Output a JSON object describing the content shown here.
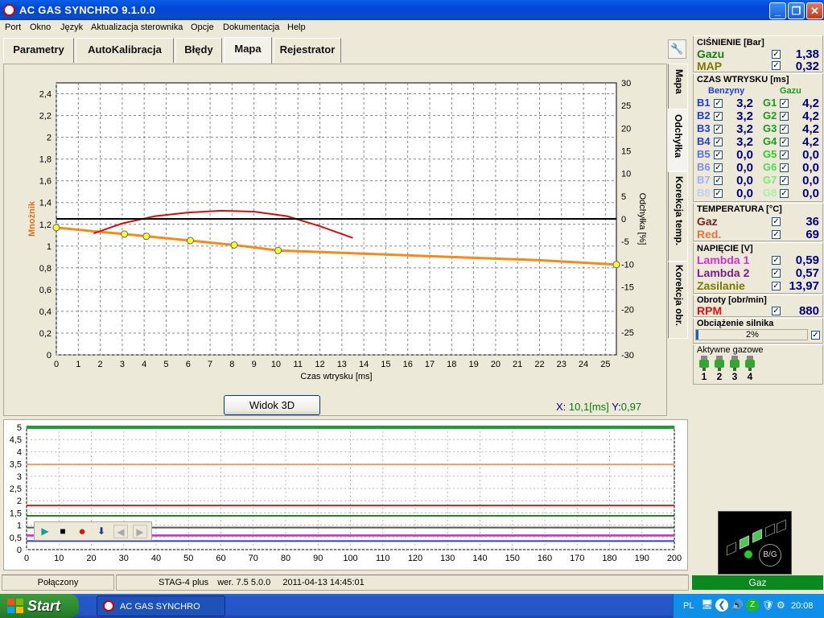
{
  "titlebar": {
    "title": "AC GAS SYNCHRO  9.1.0.0"
  },
  "menu": [
    "Port",
    "Okno",
    "Język",
    "Aktualizacja sterownika",
    "Opcje",
    "Dokumentacja",
    "Help"
  ],
  "tabs": [
    "Parametry",
    "AutoKalibracja",
    "Błędy",
    "Mapa",
    "Rejestrator"
  ],
  "active_tab": "Mapa",
  "vertical_tabs": [
    "Mapa",
    "Odchyłka",
    "Korekcja temp.",
    "Korekcja obr."
  ],
  "chart_view_button": "Widok 3D",
  "cursor_readout": {
    "x_label": "X:",
    "x_value": "10,1",
    "x_unit": "[ms]",
    "y_label": "Y:",
    "y_value": "0,97"
  },
  "chart_data": [
    {
      "type": "line",
      "xlabel": "Czas wtrysku [ms]",
      "ylabel": "Mnożnik",
      "y2label": "Odchyłka [%]",
      "xlim": [
        0,
        25.5
      ],
      "ylim": [
        0,
        2.5
      ],
      "y2lim": [
        -30,
        30
      ],
      "x_ticks": [
        "0",
        "1",
        "2",
        "3",
        "4",
        "5",
        "6",
        "7",
        "8",
        "9",
        "10",
        "11",
        "12",
        "13",
        "14",
        "15",
        "16",
        "17",
        "18",
        "19",
        "20",
        "21",
        "22",
        "23",
        "24",
        "25"
      ],
      "y_ticks": [
        "0",
        "0,2",
        "0,4",
        "0,6",
        "0,8",
        "1",
        "1,2",
        "1,4",
        "1,6",
        "1,8",
        "2",
        "2,2",
        "2,4"
      ],
      "y2_ticks": [
        "30",
        "25",
        "20",
        "15",
        "10",
        "5",
        "0",
        "-5",
        "-10",
        "-15",
        "-20",
        "-25",
        "-30"
      ],
      "grid": true,
      "series": [
        {
          "role": "multiplier",
          "color": "#f28b1c",
          "axis": "left",
          "x": [
            0,
            1.5,
            3.1,
            4.1,
            6.1,
            8.1,
            10.1,
            14,
            18,
            22,
            25.5
          ],
          "y": [
            1.17,
            1.14,
            1.11,
            1.09,
            1.05,
            1.01,
            0.96,
            0.93,
            0.9,
            0.87,
            0.83
          ],
          "markers_x": [
            0,
            3.1,
            4.1,
            6.1,
            8.1,
            10.1,
            25.5
          ],
          "markers_y": [
            1.17,
            1.11,
            1.09,
            1.05,
            1.01,
            0.96,
            0.83
          ]
        },
        {
          "role": "deviation",
          "color": "#cc1111",
          "axis": "right",
          "x": [
            1.7,
            3,
            4.5,
            6,
            7.5,
            9,
            10.5,
            12,
            13.5
          ],
          "y": [
            -3.2,
            -1.0,
            0.6,
            1.4,
            1.8,
            1.6,
            0.6,
            -1.6,
            -4.2
          ]
        },
        {
          "role": "zero-line",
          "color": "#000000",
          "axis": "right",
          "x": [
            0,
            25.5
          ],
          "y": [
            0,
            0
          ]
        }
      ]
    },
    {
      "type": "line",
      "xlim": [
        0,
        200
      ],
      "ylim": [
        0,
        5
      ],
      "x_ticks": [
        "0",
        "10",
        "20",
        "30",
        "40",
        "50",
        "60",
        "70",
        "80",
        "90",
        "100",
        "110",
        "120",
        "130",
        "140",
        "150",
        "160",
        "170",
        "180",
        "190",
        "200"
      ],
      "y_ticks": [
        "0",
        "0,5",
        "1",
        "1,5",
        "2",
        "2,5",
        "3",
        "3,5",
        "4",
        "4,5",
        "5"
      ],
      "grid": true,
      "series": [
        {
          "color": "#e0a070",
          "y": 3.48
        },
        {
          "color": "#9c2b2b",
          "y": 1.8
        },
        {
          "color": "#2a7f2a",
          "y": 1.38
        },
        {
          "color": "#555555",
          "y": 0.9
        },
        {
          "color": "#7a1f8a",
          "y": 0.57
        },
        {
          "color": "#d12fd1",
          "y": 0.59
        },
        {
          "color": "#2f3fd1",
          "y": 0.35
        },
        {
          "color": "#1f9c3a",
          "y": 5.0
        }
      ]
    }
  ],
  "status": {
    "connection": "Połączony",
    "device": "STAG-4 plus",
    "version_label": "wer.",
    "version": "7.5  5.0.0",
    "datetime": "2011-04-13 14:45:01"
  },
  "panel": {
    "pressure": {
      "header": "CIŚNIENIE [Bar]",
      "gas_label": "Gazu",
      "gas_value": "1,38",
      "map_label": "MAP",
      "map_value": "0,32"
    },
    "injection": {
      "header": "CZAS WTRYSKU  [ms]",
      "petrol_header": "Benzyny",
      "gas_header": "Gazu",
      "rows": [
        {
          "b": "B1",
          "bv": "3,2",
          "g": "G1",
          "gv": "4,2",
          "bc": "#1f3fd1",
          "gc": "#1a9b1a"
        },
        {
          "b": "B2",
          "bv": "3,2",
          "g": "G2",
          "gv": "4,2",
          "bc": "#1f3fd1",
          "gc": "#1a9b1a"
        },
        {
          "b": "B3",
          "bv": "3,2",
          "g": "G3",
          "gv": "4,2",
          "bc": "#1f3fd1",
          "gc": "#1a9b1a"
        },
        {
          "b": "B4",
          "bv": "3,2",
          "g": "G4",
          "gv": "4,2",
          "bc": "#1f3fd1",
          "gc": "#1a9b1a"
        },
        {
          "b": "B5",
          "bv": "0,0",
          "g": "G5",
          "gv": "0,0",
          "bc": "#5c6ee0",
          "gc": "#2ecb2e"
        },
        {
          "b": "B6",
          "bv": "0,0",
          "g": "G6",
          "gv": "0,0",
          "bc": "#7d8de6",
          "gc": "#4fdd4f"
        },
        {
          "b": "B7",
          "bv": "0,0",
          "g": "G7",
          "gv": "0,0",
          "bc": "#a3aff0",
          "gc": "#7ae87a"
        },
        {
          "b": "B8",
          "bv": "0,0",
          "g": "G8",
          "gv": "0,0",
          "bc": "#c5cdf6",
          "gc": "#a8f0a8"
        }
      ]
    },
    "temperature": {
      "header": "TEMPERATURA  [°C]",
      "gas_label": "Gaz",
      "gas_value": "36",
      "red_label": "Red.",
      "red_value": "69"
    },
    "voltage": {
      "header": "NAPIĘCIE [V]",
      "l1_label": "Lambda 1",
      "l1_value": "0,59",
      "l2_label": "Lambda 2",
      "l2_value": "0,57",
      "supply_label": "Zasilanie",
      "supply_value": "13,97"
    },
    "rpm": {
      "header": "Obroty [obr/min]",
      "label": "RPM",
      "value": "880"
    },
    "load": {
      "header": "Obciążenie silnika",
      "value": "2%",
      "fraction": 0.02
    },
    "active_gas": {
      "header": "Aktywne gazowe",
      "injectors": [
        "1",
        "2",
        "3",
        "4"
      ]
    },
    "switch_label": "B/G",
    "mode_bar": "Gaz"
  },
  "taskbar": {
    "start": "Start",
    "task": "AC GAS SYNCHRO",
    "lang": "PL",
    "clock": "20:08"
  },
  "colors": {
    "gas_green": "#1a7a1a",
    "map_olive": "#7a7a00",
    "gas_brown": "#7a1f1f",
    "red_orange": "#e8743a",
    "lambda1": "#d12fd1",
    "lambda2": "#7a1f8a",
    "supply": "#7a7a00",
    "rpm": "#e01010",
    "orange_series": "#f28b1c"
  },
  "icons": [
    "app-icon",
    "minimize-icon",
    "maximize-icon",
    "close-icon",
    "wrench-icon",
    "play-icon",
    "stop-icon",
    "record-icon",
    "down-arrow-icon",
    "left-arrow-icon",
    "right-arrow-icon",
    "windows-logo-icon",
    "injector-icon"
  ]
}
